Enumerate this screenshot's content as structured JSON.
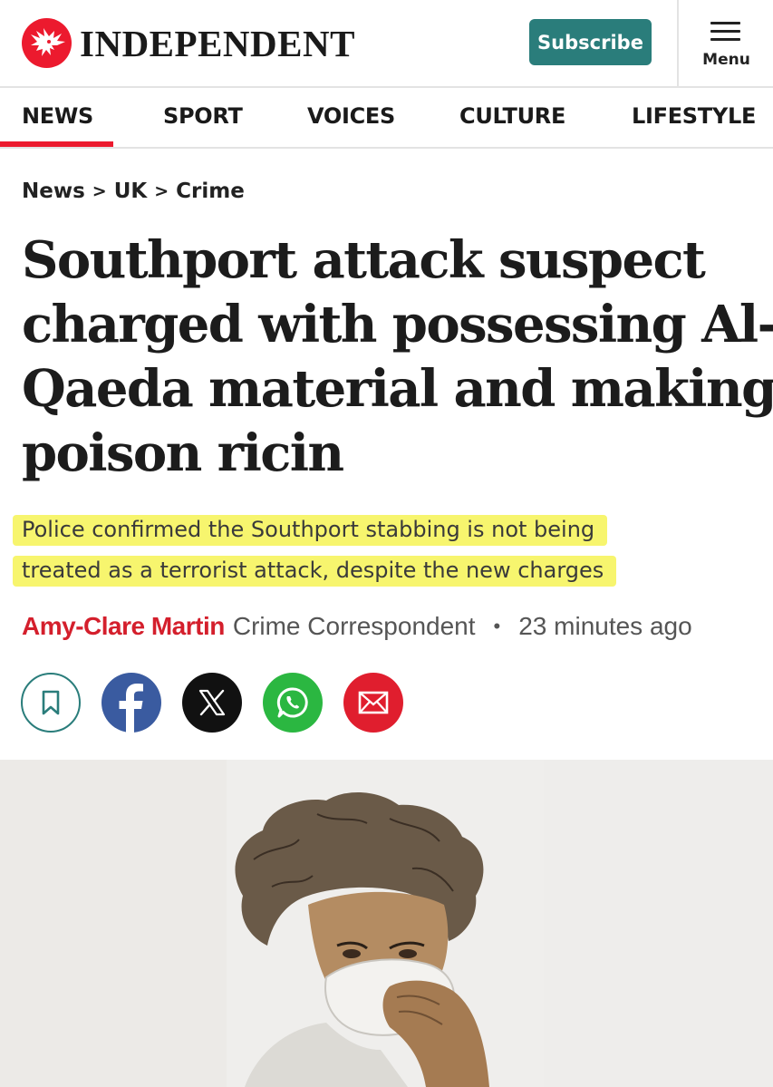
{
  "header": {
    "brand": "INDEPENDENT",
    "subscribe_label": "Subscribe",
    "menu_label": "Menu"
  },
  "nav": {
    "items": [
      {
        "label": "NEWS",
        "active": true
      },
      {
        "label": "SPORT"
      },
      {
        "label": "VOICES"
      },
      {
        "label": "CULTURE"
      },
      {
        "label": "LIFESTYLE"
      }
    ]
  },
  "breadcrumb": {
    "items": [
      "News",
      "UK",
      "Crime"
    ],
    "separator": ">"
  },
  "article": {
    "headline_lines": [
      "Southport attack suspect",
      "charged with possessing Al-",
      "Qaeda material and making",
      "poison ricin"
    ],
    "standfirst_lines": [
      "Police confirmed the Southport stabbing is not being",
      "treated as a terrorist attack, despite the new charges"
    ],
    "author": "Amy-Clare Martin",
    "author_role": "Crime Correspondent",
    "byline_separator": "•",
    "timestamp": "23 minutes ago"
  },
  "share": {
    "icons": [
      "bookmark-icon",
      "facebook-icon",
      "x-icon",
      "whatsapp-icon",
      "email-icon"
    ]
  },
  "colors": {
    "brand_red": "#ec1a2e",
    "author_red": "#d41f2c",
    "subscribe_teal": "#2a7d7b",
    "highlight_yellow": "#f7f56e",
    "facebook_blue": "#3a5ba0",
    "whatsapp_green": "#2bb741"
  }
}
